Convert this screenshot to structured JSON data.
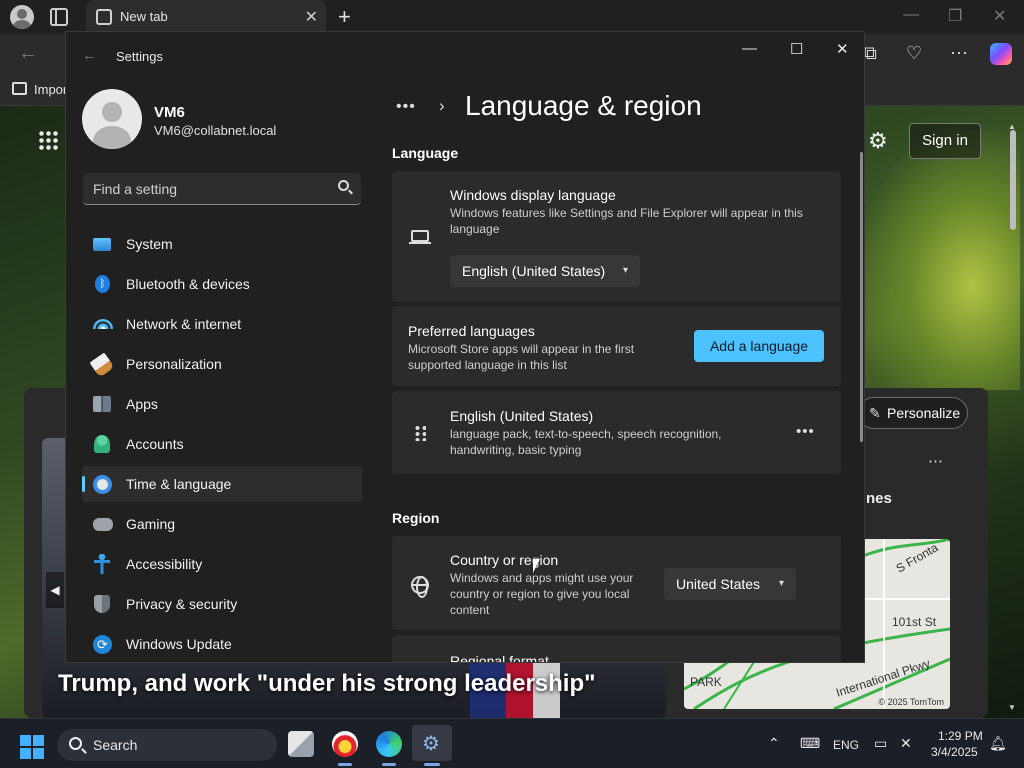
{
  "browser": {
    "tab_title": "New tab",
    "favorites_partial": "Impor",
    "sign_in": "Sign in",
    "personalize": "Personalize",
    "card_partial_title": "nes",
    "headline": "Trump, and work \"under his strong leadership\"",
    "map": {
      "street1": "S Fronta",
      "street2": "101st St",
      "street3": "International Pkwy",
      "park": "PARK",
      "copyright": "© 2025 TomTom"
    }
  },
  "settings": {
    "title": "Settings",
    "user": {
      "name": "VM6",
      "email": "VM6@collabnet.local"
    },
    "search_placeholder": "Find a setting",
    "nav": [
      {
        "label": "System",
        "icon": "system-icon"
      },
      {
        "label": "Bluetooth & devices",
        "icon": "bluetooth-icon"
      },
      {
        "label": "Network & internet",
        "icon": "wifi-icon"
      },
      {
        "label": "Personalization",
        "icon": "brush-icon"
      },
      {
        "label": "Apps",
        "icon": "apps-icon"
      },
      {
        "label": "Accounts",
        "icon": "accounts-icon"
      },
      {
        "label": "Time & language",
        "icon": "time-language-icon",
        "active": true
      },
      {
        "label": "Gaming",
        "icon": "gamepad-icon"
      },
      {
        "label": "Accessibility",
        "icon": "accessibility-icon"
      },
      {
        "label": "Privacy & security",
        "icon": "shield-icon"
      },
      {
        "label": "Windows Update",
        "icon": "update-icon"
      }
    ],
    "page_title": "Language & region",
    "language_section": "Language",
    "display_language": {
      "title": "Windows display language",
      "desc": "Windows features like Settings and File Explorer will appear in this language",
      "value": "English (United States)"
    },
    "preferred": {
      "title": "Preferred languages",
      "desc": "Microsoft Store apps will appear in the first supported language in this list",
      "button": "Add a language"
    },
    "installed_language": {
      "title": "English (United States)",
      "desc": "language pack, text-to-speech, speech recognition, handwriting, basic typing"
    },
    "region_section": "Region",
    "country": {
      "title": "Country or region",
      "desc": "Windows and apps might use your country or region to give you local content",
      "value": "United States"
    },
    "regional_format_partial": "Regional format"
  },
  "taskbar": {
    "search_label": "Search",
    "language": "ENG",
    "time": "1:29 PM",
    "date": "3/4/2025"
  },
  "colors": {
    "accent": "#4cc2ff",
    "window_bg": "#202020",
    "card_bg": "#2b2b2b"
  }
}
